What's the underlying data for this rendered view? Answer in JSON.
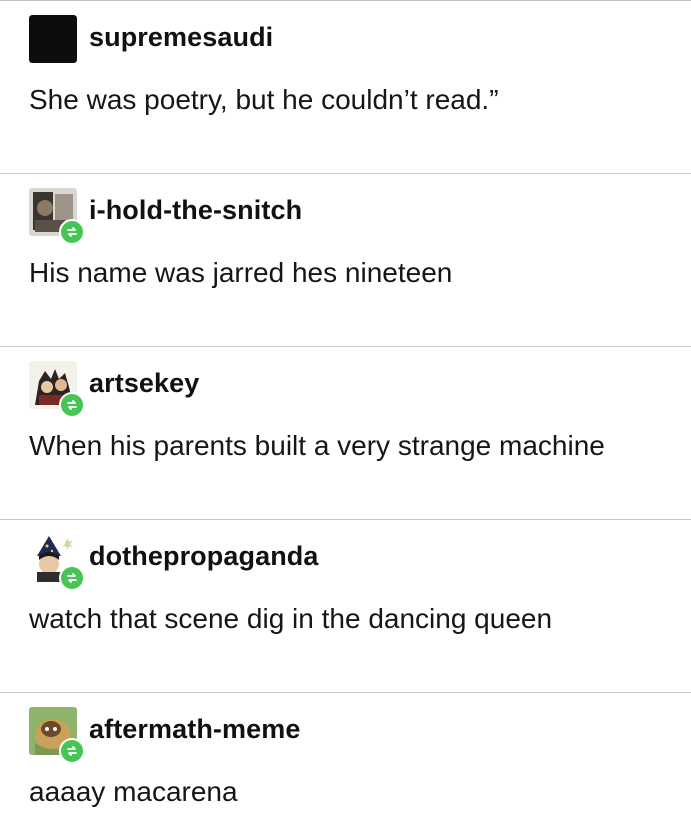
{
  "posts": [
    {
      "username": "supremesaudi",
      "text": "She was poetry, but he couldn’t read.”",
      "avatar_icon": "black-square-avatar",
      "reblogged": false
    },
    {
      "username": "i-hold-the-snitch",
      "text": "His name was jarred hes nineteen",
      "avatar_icon": "photo-avatar",
      "reblogged": true
    },
    {
      "username": "artsekey",
      "text": "When his parents built a very strange machine",
      "avatar_icon": "illustrated-characters-avatar",
      "reblogged": true
    },
    {
      "username": "dothepropaganda",
      "text": "watch that scene dig in the dancing queen",
      "avatar_icon": "wizard-hat-avatar",
      "reblogged": true
    },
    {
      "username": "aftermath-meme",
      "text": "aaaay macarena",
      "avatar_icon": "cartoon-animal-avatar",
      "reblogged": true
    }
  ],
  "colors": {
    "reblog_badge": "#46c554",
    "divider": "#c8c8c8",
    "text": "#161616"
  }
}
